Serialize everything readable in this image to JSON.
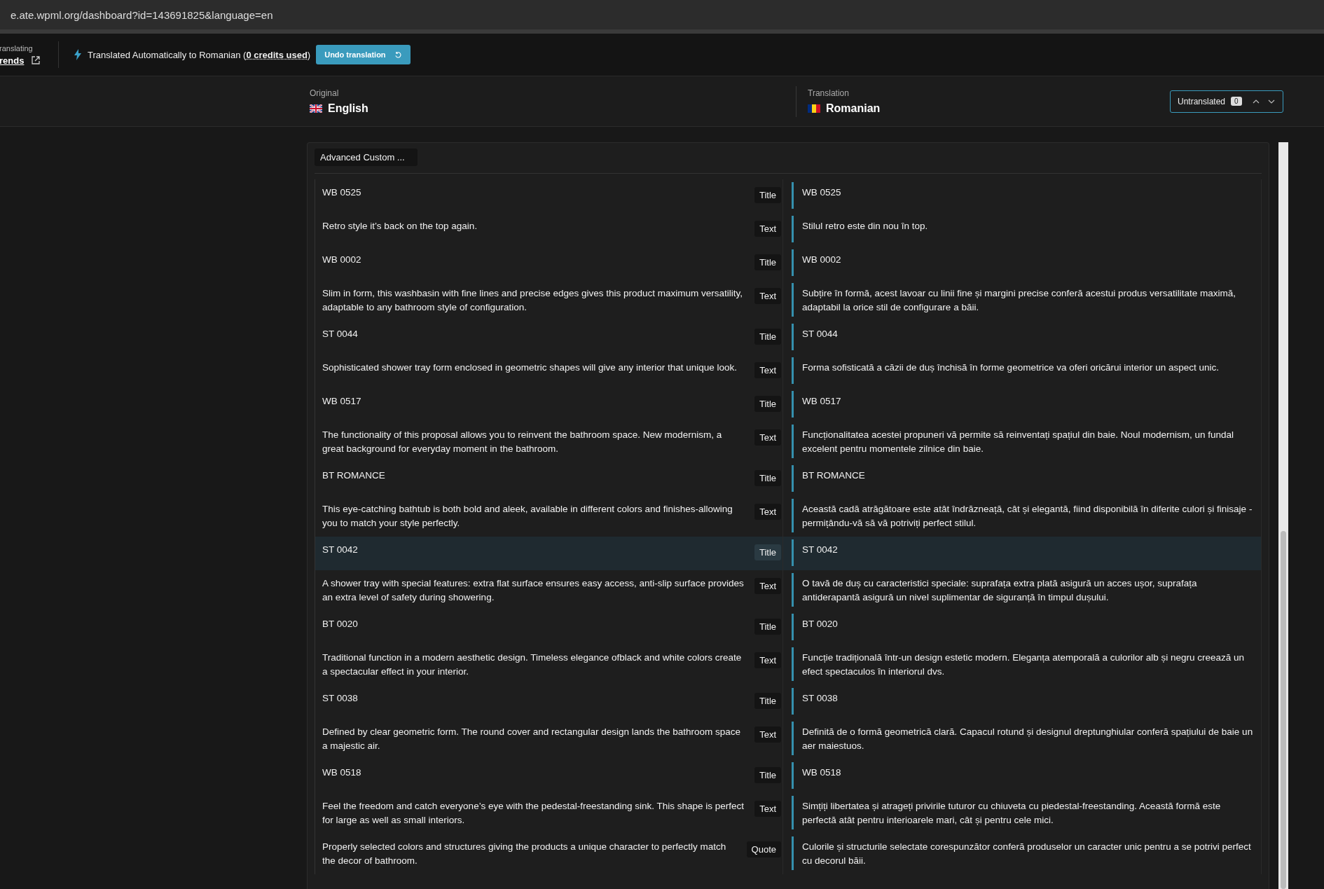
{
  "address_bar": {
    "url": "e.ate.wpml.org/dashboard?id=143691825&language=en"
  },
  "toolbar": {
    "context_label": "ranslating",
    "context_link": "rends",
    "status_text": "Translated Automatically to Romanian (",
    "credits_text": "0 credits used",
    "status_end": ")",
    "undo_button": "Undo translation"
  },
  "header": {
    "original_label": "Original",
    "original_language": "English",
    "translation_label": "Translation",
    "translation_language": "Romanian",
    "filter": {
      "label": "Untranslated",
      "count": "0"
    }
  },
  "section_chip": "Advanced Custom ...",
  "rows": [
    {
      "original": "WB 0525",
      "tag": "Title",
      "translation": "WB 0525",
      "selected": false
    },
    {
      "original": "Retro style it’s back on the top again.",
      "tag": "Text",
      "translation": "Stilul retro este din nou în top.",
      "selected": false
    },
    {
      "original": "WB 0002",
      "tag": "Title",
      "translation": "WB 0002",
      "selected": false
    },
    {
      "original": "Slim in form, this washbasin with fine lines and precise edges gives this product maximum versatility, adaptable to any bathroom style of configuration.",
      "tag": "Text",
      "translation": "Subțire în formă, acest lavoar cu linii fine și margini precise conferă acestui produs versatilitate maximă, adaptabil la orice stil de configurare a băii.",
      "selected": false
    },
    {
      "original": "ST 0044",
      "tag": "Title",
      "translation": "ST 0044",
      "selected": false
    },
    {
      "original": "Sophisticated shower tray form enclosed in geometric shapes will give any interior that unique look.",
      "tag": "Text",
      "translation": "Forma sofisticată a căzii de duș închisă în forme geometrice va oferi oricărui interior un aspect unic.",
      "selected": false
    },
    {
      "original": "WB 0517",
      "tag": "Title",
      "translation": "WB 0517",
      "selected": false
    },
    {
      "original": "The functionality of this proposal allows you to reinvent the bathroom space. New modernism, a great background for everyday moment in the bathroom.",
      "tag": "Text",
      "translation": "Funcționalitatea acestei propuneri vă permite să reinventați spațiul din baie. Noul modernism, un fundal excelent pentru momentele zilnice din baie.",
      "selected": false
    },
    {
      "original": "BT ROMANCE",
      "tag": "Title",
      "translation": "BT ROMANCE",
      "selected": false
    },
    {
      "original": "This eye-catching bathtub is both bold and aleek, available in different colors and finishes-allowing you to match your style perfectly.",
      "tag": "Text",
      "translation": "Această cadă atrăgătoare este atât îndrăzneață, cât și elegantă, fiind disponibilă în diferite culori și finisaje - permițându-vă să vă potriviți perfect stilul.",
      "selected": false
    },
    {
      "original": "ST 0042",
      "tag": "Title",
      "translation": "ST 0042",
      "selected": true
    },
    {
      "original": "A shower tray with special features: extra flat surface ensures easy access, anti-slip surface provides an extra level of safety during showering.",
      "tag": "Text",
      "translation": "O tavă de duș cu caracteristici speciale: suprafața extra plată asigură un acces ușor, suprafața antiderapantă asigură un nivel suplimentar de siguranță în timpul dușului.",
      "selected": false
    },
    {
      "original": "BT 0020",
      "tag": "Title",
      "translation": "BT 0020",
      "selected": false
    },
    {
      "original": "Traditional function in a modern aesthetic design. Timeless elegance ofblack and white colors create a spectacular effect in your interior.",
      "tag": "Text",
      "translation": "Funcție tradițională într-un design estetic modern. Eleganța atemporală a culorilor alb și negru creează un efect spectaculos în interiorul dvs.",
      "selected": false
    },
    {
      "original": "ST 0038",
      "tag": "Title",
      "translation": "ST 0038",
      "selected": false
    },
    {
      "original": "Defined by clear geometric form. The round cover and rectangular design lands the bathroom space a majestic air.",
      "tag": "Text",
      "translation": "Definită de o formă geometrică clară. Capacul rotund și designul dreptunghiular conferă spațiului de baie un aer maiestuos.",
      "selected": false
    },
    {
      "original": "WB 0518",
      "tag": "Title",
      "translation": "WB 0518",
      "selected": false
    },
    {
      "original": "Feel the freedom and catch everyone’s eye with the pedestal-freestanding sink. This shape is perfect for large as well as small interiors.",
      "tag": "Text",
      "translation": "Simțiți libertatea și atrageți privirile tuturor cu chiuveta cu piedestal-freestanding. Această formă este perfectă atât pentru interioarele mari, cât și pentru cele mici.",
      "selected": false
    },
    {
      "original": "Properly selected colors and structures giving the products a unique character to perfectly match the decor of bathroom.",
      "tag": "Quote",
      "translation": "Culorile și structurile selectate corespunzător conferă produselor un caracter unic pentru a se potrivi perfect cu decorul băii.",
      "selected": false
    }
  ]
}
